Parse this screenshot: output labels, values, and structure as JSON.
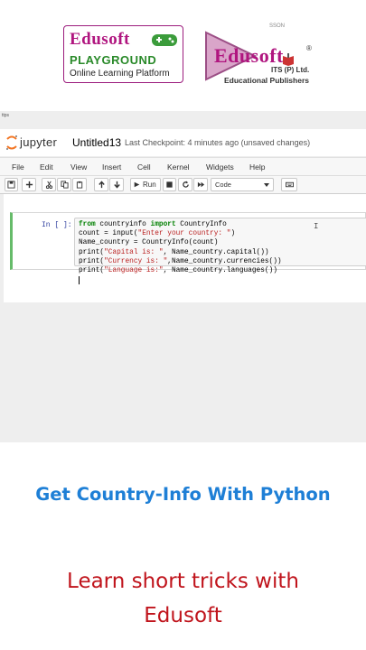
{
  "logo_left": {
    "title": "Edusoft",
    "subtitle": "PLAYGROUND",
    "tagline": "Online Learning Platform",
    "icon": "gamepad-icon",
    "color": "#b0157f"
  },
  "logo_right": {
    "since": "SSON",
    "title": "Edusoft",
    "registered": "®",
    "its": "ITS (P) Ltd.",
    "tagline": "Educational Publishers",
    "icon": "play-book-icon",
    "color": "#b0157f"
  },
  "jupyter": {
    "url_fragment": "ttps",
    "brand": "jupyter",
    "notebook_title": "Untitled13",
    "checkpoint": "Last Checkpoint: 4 minutes ago  (unsaved changes)",
    "menu": [
      "File",
      "Edit",
      "View",
      "Insert",
      "Cell",
      "Kernel",
      "Widgets",
      "Help"
    ],
    "toolbar": {
      "run_label": "Run",
      "cell_type": "Code",
      "buttons": [
        "save-icon",
        "plus-icon",
        "scissors-icon",
        "copy-icon",
        "paste-icon",
        "arrow-up-icon",
        "arrow-down-icon",
        "run-icon",
        "stop-icon",
        "restart-icon",
        "fast-forward-icon",
        "keyboard-icon"
      ]
    },
    "cell": {
      "prompt": "In [ ]:",
      "lines": [
        [
          [
            "kw",
            "from"
          ],
          [
            "",
            " countryinfo "
          ],
          [
            "kw",
            "import"
          ],
          [
            "",
            " CountryInfo"
          ]
        ],
        [
          [
            "",
            "count = input("
          ],
          [
            "str",
            "\"Enter your country: \""
          ],
          [
            "",
            ")"
          ]
        ],
        [
          [
            "",
            "Name_country = CountryInfo(count)"
          ]
        ],
        [
          [
            "",
            "print("
          ],
          [
            "str",
            "\"Capital is: \""
          ],
          [
            "",
            ", Name_country.capital())"
          ]
        ],
        [
          [
            "",
            "print("
          ],
          [
            "str",
            "\"Currency is: \""
          ],
          [
            "",
            ",Name_country.currencies())"
          ]
        ],
        [
          [
            "",
            "print("
          ],
          [
            "str",
            "\"Language is:\""
          ],
          [
            "",
            ", Name_country.languages())"
          ]
        ]
      ]
    }
  },
  "heading": "Get Country-Info With Python",
  "tagline_line1": "Learn short tricks with",
  "tagline_line2": "Edusoft",
  "colors": {
    "heading": "#1e7fd6",
    "tagline": "#c0141c",
    "cell_border": "#66bb6a"
  }
}
